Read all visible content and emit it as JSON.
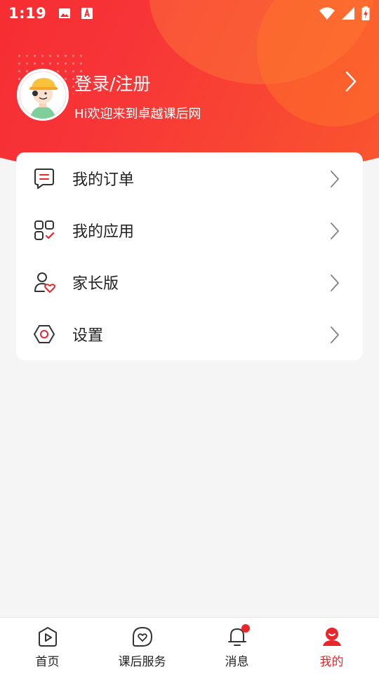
{
  "status_bar": {
    "time": "1:19",
    "icons": [
      "image-icon",
      "a-text-icon",
      "wifi-icon",
      "signal-icon",
      "battery-icon"
    ]
  },
  "profile": {
    "title": "登录/注册",
    "subtitle": "Hi欢迎来到卓越课后网"
  },
  "menu": {
    "items": [
      {
        "label": "我的订单",
        "icon": "order-icon"
      },
      {
        "label": "我的应用",
        "icon": "apps-icon"
      },
      {
        "label": "家长版",
        "icon": "parent-icon"
      },
      {
        "label": "设置",
        "icon": "settings-icon"
      }
    ]
  },
  "bottom_nav": {
    "items": [
      {
        "label": "首页",
        "icon": "home-play-icon",
        "active": false
      },
      {
        "label": "课后服务",
        "icon": "heart-service-icon",
        "active": false
      },
      {
        "label": "消息",
        "icon": "bell-icon",
        "active": false,
        "badge": true
      },
      {
        "label": "我的",
        "icon": "profile-icon",
        "active": true
      }
    ]
  },
  "colors": {
    "brand_red": "#e8262b",
    "header_gradient_start": "#f5262c",
    "header_gradient_end": "#fa5a2e",
    "background": "#f5f5f5"
  }
}
